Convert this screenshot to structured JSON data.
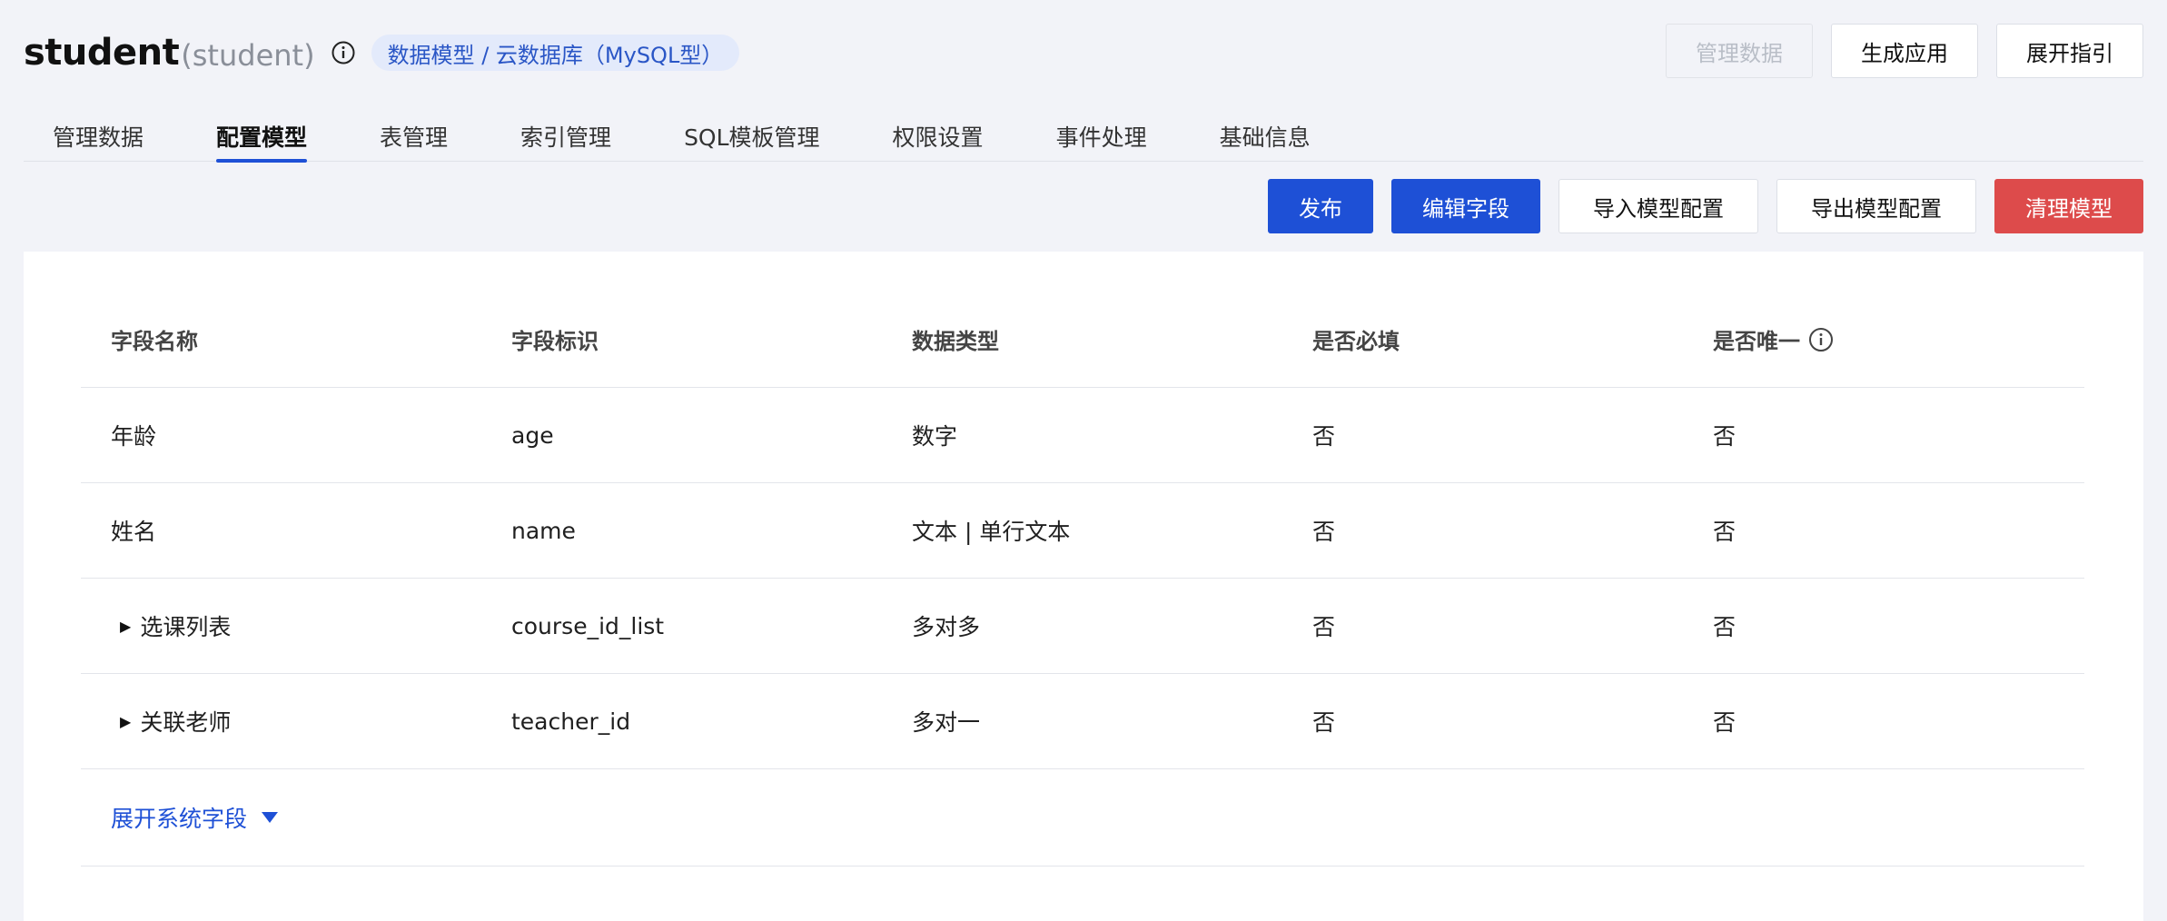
{
  "header": {
    "title": "student",
    "subtitle": "(student)",
    "badge": "数据模型 / 云数据库（MySQL型）",
    "actions": [
      "管理数据",
      "生成应用",
      "展开指引"
    ]
  },
  "tabs": [
    {
      "label": "管理数据",
      "active": false
    },
    {
      "label": "配置模型",
      "active": true
    },
    {
      "label": "表管理",
      "active": false
    },
    {
      "label": "索引管理",
      "active": false
    },
    {
      "label": "SQL模板管理",
      "active": false
    },
    {
      "label": "权限设置",
      "active": false
    },
    {
      "label": "事件处理",
      "active": false
    },
    {
      "label": "基础信息",
      "active": false
    }
  ],
  "toolbar": {
    "publish": "发布",
    "edit_fields": "编辑字段",
    "import_config": "导入模型配置",
    "export_config": "导出模型配置",
    "clear_model": "清理模型"
  },
  "table": {
    "columns": [
      "字段名称",
      "字段标识",
      "数据类型",
      "是否必填",
      "是否唯一"
    ],
    "rows": [
      {
        "name": "年龄",
        "id": "age",
        "type": "数字",
        "required": "否",
        "unique": "否",
        "expandable": false
      },
      {
        "name": "姓名",
        "id": "name",
        "type": "文本 | 单行文本",
        "required": "否",
        "unique": "否",
        "expandable": false
      },
      {
        "name": "选课列表",
        "id": "course_id_list",
        "type": "多对多",
        "required": "否",
        "unique": "否",
        "expandable": true
      },
      {
        "name": "关联老师",
        "id": "teacher_id",
        "type": "多对一",
        "required": "否",
        "unique": "否",
        "expandable": true
      }
    ],
    "expand_system_fields": "展开系统字段"
  },
  "colors": {
    "primary": "#1e50d6",
    "danger": "#dd4b4b",
    "badge_bg": "#e3eafb"
  }
}
